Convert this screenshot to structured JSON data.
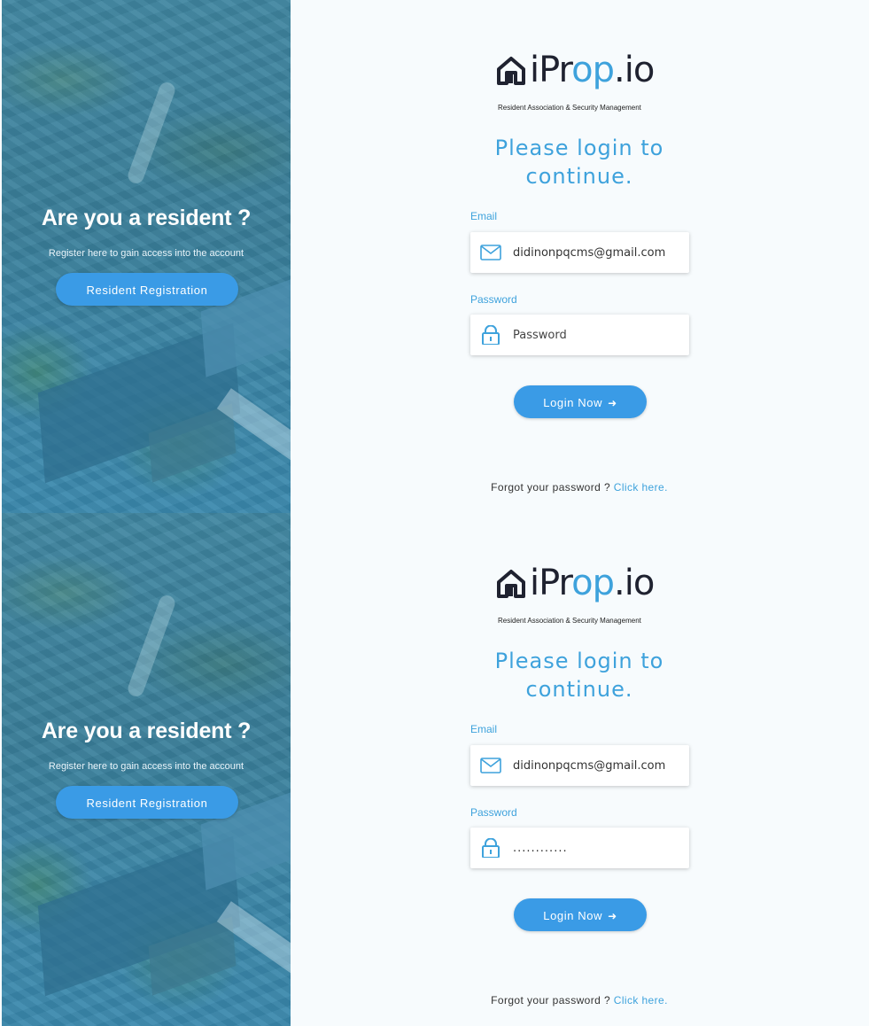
{
  "hero": {
    "title": "Are you a resident ?",
    "subtitle": "Register here to gain access into the account",
    "button_label": "Resident Registration"
  },
  "brand": {
    "name_dark": "iPr",
    "name_blue": "op",
    "name_suffix": ".io",
    "tagline": "Resident Association & Security Management",
    "accent_color": "#3ea2dc",
    "dark_color": "#1f2230"
  },
  "login": {
    "heading": "Please login to continue.",
    "email_label": "Email",
    "password_label": "Password",
    "login_button": "Login Now",
    "login_icon": "sign-in-icon",
    "forgot_text": "Forgot your password ?",
    "forgot_link": "Click here."
  },
  "frames": [
    {
      "email_value": "didinonpqcms@gmail.com",
      "password_value": "",
      "password_placeholder": "Password"
    },
    {
      "email_value": "didinonpqcms@gmail.com",
      "password_value": "............",
      "password_placeholder": "Password"
    }
  ],
  "colors": {
    "button_bg": "#3a9be6",
    "page_bg": "#f7fbfd"
  }
}
